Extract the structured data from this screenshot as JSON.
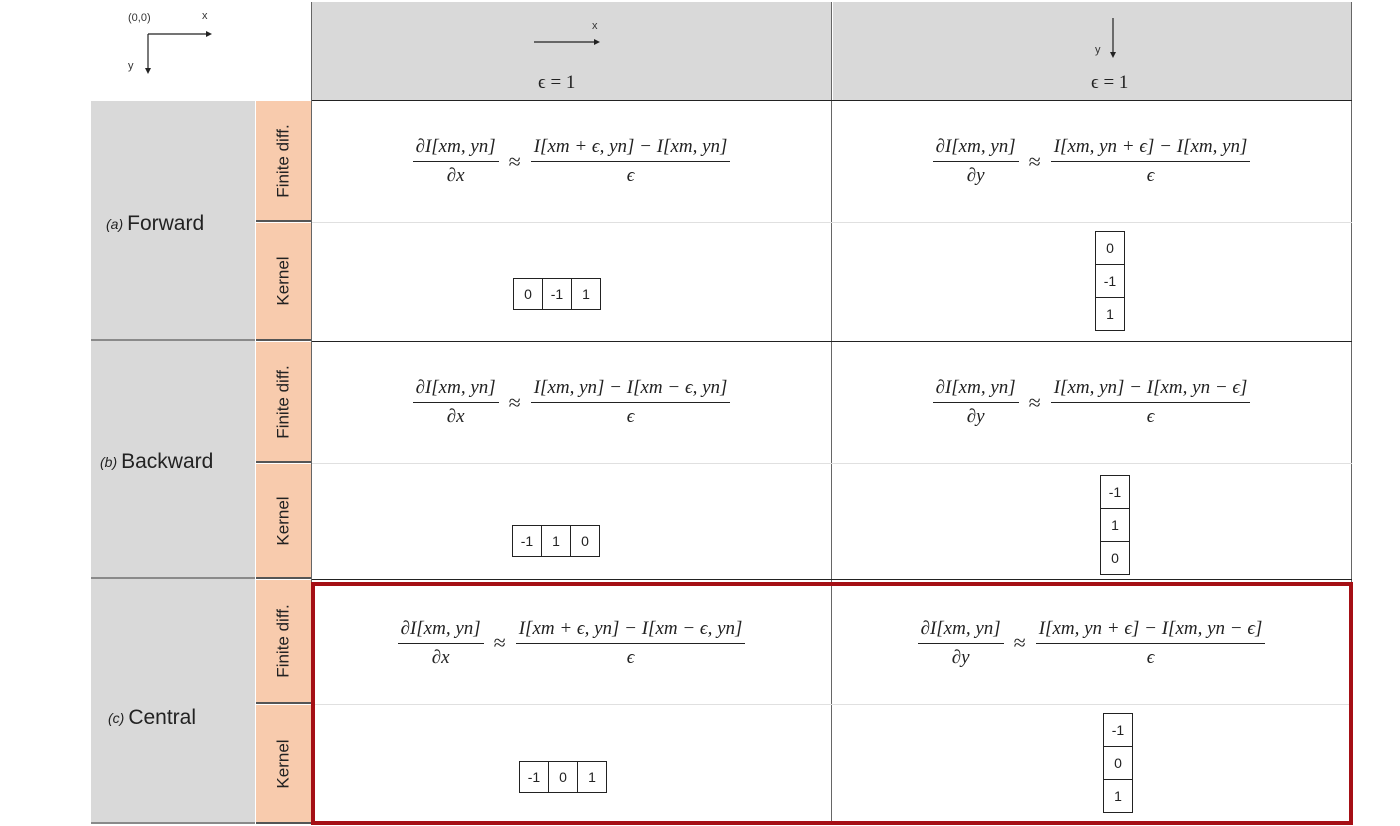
{
  "origin": {
    "origin_label": "(0,0)",
    "x_label": "x",
    "y_label": "y"
  },
  "columns": [
    {
      "axis_label": "x",
      "epsilon_label": "ϵ = 1"
    },
    {
      "axis_label": "y",
      "epsilon_label": "ϵ = 1"
    }
  ],
  "sub_rows": {
    "finite_diff": "Finite diff.",
    "kernel": "Kernel"
  },
  "groups": [
    {
      "tag": "(a)",
      "name": "Forward",
      "x_formula": {
        "lhs_num": "∂I[xm, yn]",
        "lhs_den": "∂x",
        "rhs_num": "I[xm + ϵ, yn] − I[xm, yn]",
        "rhs_den": "ϵ"
      },
      "y_formula": {
        "lhs_num": "∂I[xm, yn]",
        "lhs_den": "∂y",
        "rhs_num": "I[xm, yn + ϵ] − I[xm, yn]",
        "rhs_den": "ϵ"
      },
      "x_kernel": [
        "0",
        "-1",
        "1"
      ],
      "y_kernel": [
        "0",
        "-1",
        "1"
      ]
    },
    {
      "tag": "(b)",
      "name": "Backward",
      "x_formula": {
        "lhs_num": "∂I[xm, yn]",
        "lhs_den": "∂x",
        "rhs_num": "I[xm, yn] − I[xm − ϵ, yn]",
        "rhs_den": "ϵ"
      },
      "y_formula": {
        "lhs_num": "∂I[xm, yn]",
        "lhs_den": "∂y",
        "rhs_num": "I[xm, yn] − I[xm, yn − ϵ]",
        "rhs_den": "ϵ"
      },
      "x_kernel": [
        "-1",
        "1",
        "0"
      ],
      "y_kernel": [
        "-1",
        "1",
        "0"
      ]
    },
    {
      "tag": "(c)",
      "name": "Central",
      "x_formula": {
        "lhs_num": "∂I[xm, yn]",
        "lhs_den": "∂x",
        "rhs_num": "I[xm + ϵ, yn] − I[xm − ϵ, yn]",
        "rhs_den": "ϵ"
      },
      "y_formula": {
        "lhs_num": "∂I[xm, yn]",
        "lhs_den": "∂y",
        "rhs_num": "I[xm, yn + ϵ] − I[xm, yn − ϵ]",
        "rhs_den": "ϵ"
      },
      "x_kernel": [
        "-1",
        "0",
        "1"
      ],
      "y_kernel": [
        "-1",
        "0",
        "1"
      ]
    }
  ],
  "colors": {
    "header_bg": "#d9d9d9",
    "subrow_bg": "#f8cbad",
    "highlight_border": "#a50f15"
  }
}
